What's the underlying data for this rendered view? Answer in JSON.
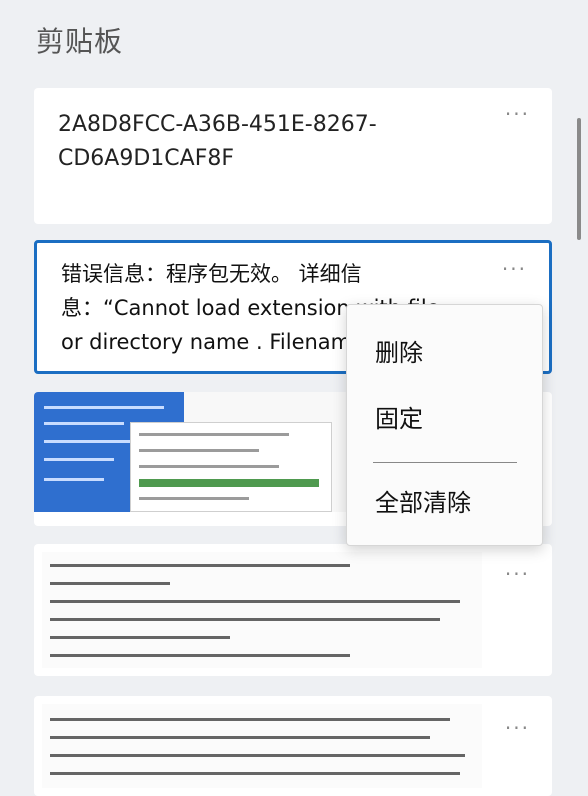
{
  "panel": {
    "title": "剪贴板"
  },
  "items": [
    {
      "text": "2A8D8FCC-A36B-451E-8267-\nCD6A9D1CAF8F",
      "more": "···"
    },
    {
      "text": "错误信息：程序包无效。 详细信\n息：“Cannot load extension with file\nor directory name . Filename",
      "more": "···"
    },
    {
      "kind": "screenshot",
      "more": "···"
    },
    {
      "kind": "scanned-document",
      "more": "···"
    },
    {
      "kind": "scanned-document",
      "more": "···"
    }
  ],
  "context_menu": {
    "items": [
      "删除",
      "固定",
      "全部清除"
    ]
  },
  "colors": {
    "selection_border": "#1b6ec2",
    "background": "#eef0f3"
  }
}
